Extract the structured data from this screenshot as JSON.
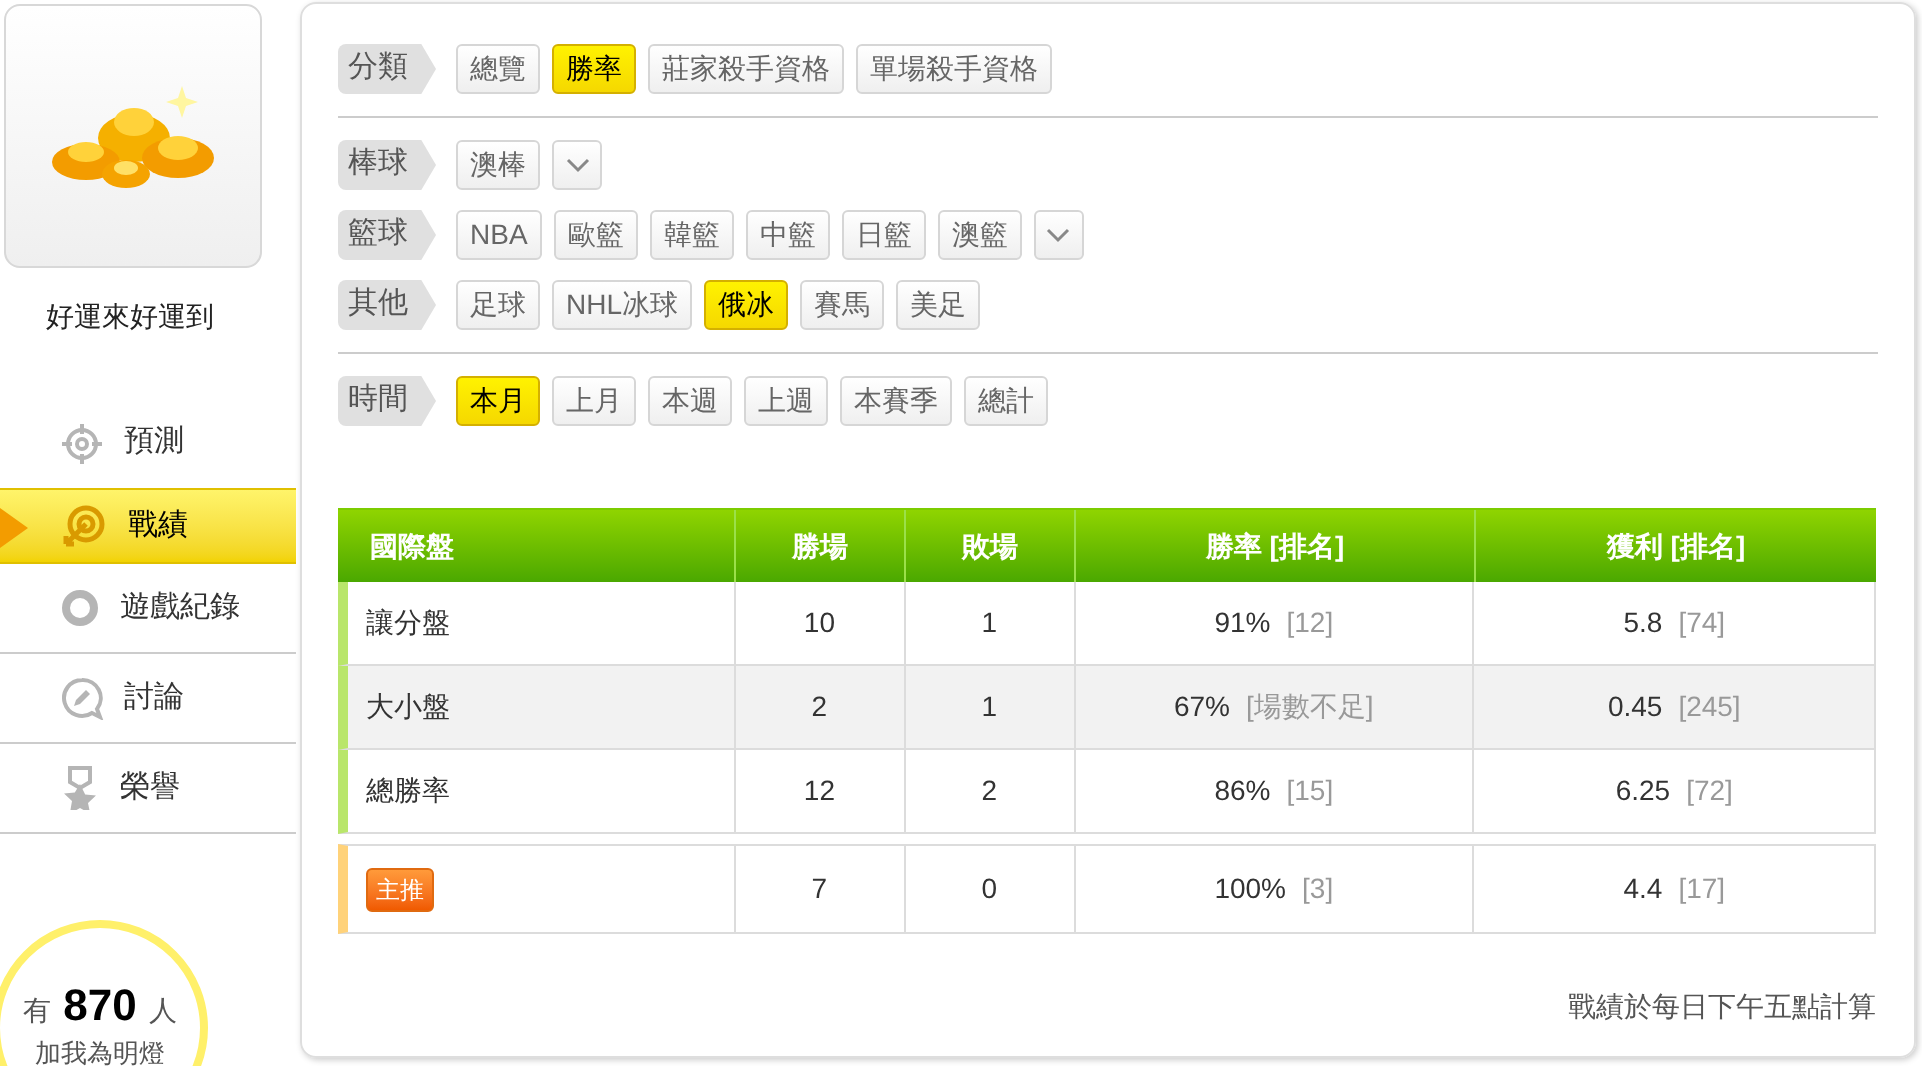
{
  "profile": {
    "name": "好運來好運到"
  },
  "nav": [
    {
      "label": "預測",
      "selected": false
    },
    {
      "label": "戰績",
      "selected": true
    },
    {
      "label": "遊戲紀錄",
      "selected": false
    },
    {
      "label": "討論",
      "selected": false
    },
    {
      "label": "榮譽",
      "selected": false
    }
  ],
  "fans": {
    "prefix": "有",
    "count": "870",
    "suffix": "人",
    "action": "加我為明燈"
  },
  "filter_groups": [
    {
      "filters": [
        {
          "label": "分類",
          "more": false,
          "options": [
            {
              "label": "總覽",
              "selected": false
            },
            {
              "label": "勝率",
              "selected": true
            },
            {
              "label": "莊家殺手資格",
              "selected": false
            },
            {
              "label": "單場殺手資格",
              "selected": false
            }
          ]
        }
      ]
    },
    {
      "filters": [
        {
          "label": "棒球",
          "more": true,
          "options": [
            {
              "label": "澳棒",
              "selected": false
            }
          ]
        },
        {
          "label": "籃球",
          "more": true,
          "options": [
            {
              "label": "NBA",
              "selected": false
            },
            {
              "label": "歐籃",
              "selected": false
            },
            {
              "label": "韓籃",
              "selected": false
            },
            {
              "label": "中籃",
              "selected": false
            },
            {
              "label": "日籃",
              "selected": false
            },
            {
              "label": "澳籃",
              "selected": false
            }
          ]
        },
        {
          "label": "其他",
          "more": false,
          "options": [
            {
              "label": "足球",
              "selected": false
            },
            {
              "label": "NHL冰球",
              "selected": false
            },
            {
              "label": "俄冰",
              "selected": true
            },
            {
              "label": "賽馬",
              "selected": false
            },
            {
              "label": "美足",
              "selected": false
            }
          ]
        }
      ]
    },
    {
      "filters": [
        {
          "label": "時間",
          "more": false,
          "options": [
            {
              "label": "本月",
              "selected": true
            },
            {
              "label": "上月",
              "selected": false
            },
            {
              "label": "本週",
              "selected": false
            },
            {
              "label": "上週",
              "selected": false
            },
            {
              "label": "本賽季",
              "selected": false
            },
            {
              "label": "總計",
              "selected": false
            }
          ]
        }
      ]
    }
  ],
  "table": {
    "columns": [
      "國際盤",
      "勝場",
      "敗場",
      "勝率 [排名]",
      "獲利 [排名]"
    ],
    "rows": [
      {
        "kind": "normal",
        "name": "讓分盤",
        "wins": "10",
        "losses": "1",
        "rate": "91%",
        "rate_rank": "[12]",
        "profit": "5.8",
        "profit_rank": "[74]"
      },
      {
        "kind": "normal",
        "name": "大小盤",
        "wins": "2",
        "losses": "1",
        "rate": "67%",
        "rate_rank": "[場數不足]",
        "profit": "0.45",
        "profit_rank": "[245]"
      },
      {
        "kind": "normal",
        "name": "總勝率",
        "wins": "12",
        "losses": "2",
        "rate": "86%",
        "rate_rank": "[15]",
        "profit": "6.25",
        "profit_rank": "[72]"
      },
      {
        "kind": "featured",
        "name": "主推",
        "wins": "7",
        "losses": "0",
        "rate": "100%",
        "rate_rank": "[3]",
        "profit": "4.4",
        "profit_rank": "[17]"
      }
    ]
  },
  "note": "戰績於每日下午五點計算"
}
